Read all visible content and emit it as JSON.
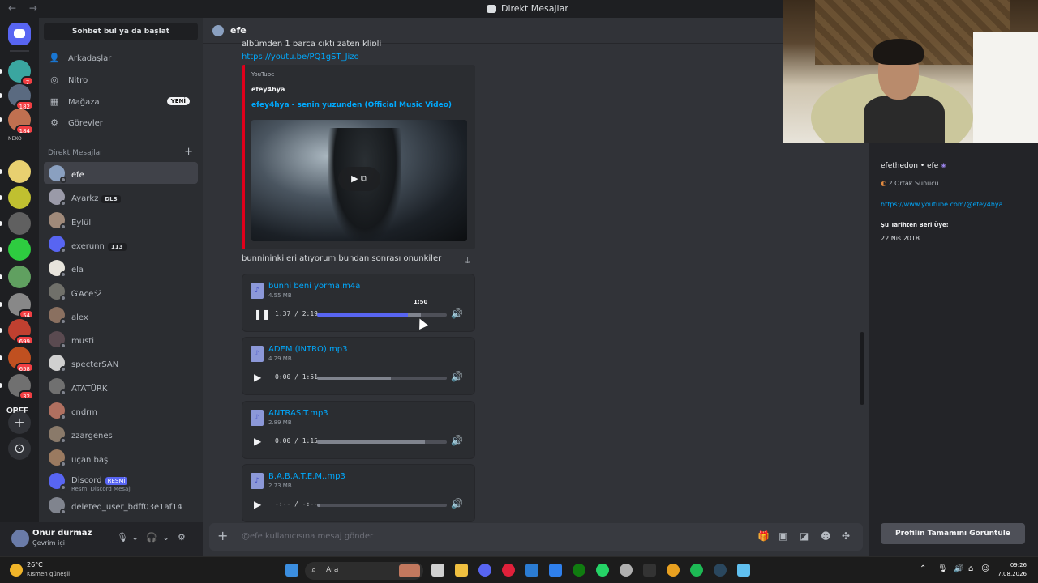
{
  "titlebar": {
    "nav": "← →",
    "title": "Direkt Mesajlar"
  },
  "rail": {
    "servers": [
      {
        "badge": "7"
      },
      {
        "badge": "182"
      },
      {
        "badge": "184"
      },
      {
        "badge": ""
      },
      {
        "badge": ""
      },
      {
        "badge": ""
      },
      {
        "badge": ""
      },
      {
        "badge": ""
      },
      {
        "badge": "54"
      },
      {
        "badge": "699"
      },
      {
        "badge": "658"
      },
      {
        "badge": "32"
      }
    ],
    "text_server": "OBFF",
    "add_label": "+",
    "explore_label": "⊙"
  },
  "sidebar": {
    "search_label": "Sohbet bul ya da başlat",
    "nav": [
      {
        "label": "Arkadaşlar",
        "icon": "friends-icon"
      },
      {
        "label": "Nitro",
        "icon": "nitro-icon"
      },
      {
        "label": "Mağaza",
        "icon": "shop-icon",
        "badge": "YENİ"
      },
      {
        "label": "Görevler",
        "icon": "quests-icon"
      }
    ],
    "dm_header": "Direkt Mesajlar",
    "dm_add": "+",
    "dms": [
      {
        "name": "efe",
        "color": "#8aa0c0",
        "active": true
      },
      {
        "name": "Ayarkz",
        "color": "#9a9aa8",
        "tag": "DLS"
      },
      {
        "name": "Eylül",
        "color": "#a08a7a"
      },
      {
        "name": "exerunn",
        "color": "#5865f2",
        "tag": "113"
      },
      {
        "name": "ela",
        "color": "#e7e4dc"
      },
      {
        "name": "ᏳAceジ",
        "color": "#70706a"
      },
      {
        "name": "alex",
        "color": "#8a7060"
      },
      {
        "name": "musti",
        "color": "#5a4a50"
      },
      {
        "name": "specterSAN",
        "color": "#d0d0d0"
      },
      {
        "name": "ATATÜRK",
        "color": "#707070"
      },
      {
        "name": "cndrm",
        "color": "#b07060"
      },
      {
        "name": "zzargenes",
        "color": "#8a7a6a"
      },
      {
        "name": "uçan baş",
        "color": "#9a7a60"
      },
      {
        "name": "Discord",
        "color": "#5865f2",
        "tag": "RESMİ",
        "sub": "Resmi Discord Mesajı"
      },
      {
        "name": "deleted_user_bdff03e1af14",
        "color": "#80848e"
      }
    ]
  },
  "user": {
    "name": "Onur durmaz",
    "status": "Çevrim içi",
    "mic": "🎙",
    "headset": "🎧",
    "settings": "⚙",
    "caret": "⌄"
  },
  "chat": {
    "header": "efe",
    "partial_text": "albümden 1 parça çıktı zaten klipli",
    "link": "https://youtu.be/PQ1gST_Jizo",
    "embed": {
      "provider": "YouTube",
      "author": "efey4hya",
      "title": "efey4hya - senin yuzunden (Official Music Video)",
      "play": "▶ ⧉"
    },
    "message2": "bunnininkileri atıyorum bundan sonrası onunkiler",
    "audios": [
      {
        "name": "bunni beni yorma.m4a",
        "size": "4.55 MB",
        "time": "1:37 / 2:19",
        "progress": 0.7,
        "buffered": 0.8,
        "play": "❚❚",
        "hover": "1:50"
      },
      {
        "name": "ADEM (INTRO).mp3",
        "size": "4.29 MB",
        "time": "0:00 / 1:51",
        "progress": 0.0,
        "buffered": 0.57,
        "play": "▶"
      },
      {
        "name": "ANTRASIT.mp3",
        "size": "2.89 MB",
        "time": "0:00 / 1:15",
        "progress": 0.0,
        "buffered": 0.83,
        "play": "▶"
      },
      {
        "name": "B.A.B.A.T.E.M..mp3",
        "size": "2.73 MB",
        "time": "-:-- / -:--",
        "progress": 0.0,
        "buffered": 0.02,
        "play": "▶"
      }
    ],
    "input_placeholder": "@efe kullanıcısına mesaj gönder",
    "input_plus": "+"
  },
  "profile": {
    "handle": "efethedon",
    "display": "efe",
    "mutual": "2 Ortak Sunucu",
    "link": "https://www.youtube.com/@efey4hya",
    "member_since_label": "Şu Tarihten Beri Üye:",
    "member_since": "22 Nis 2018",
    "full_button": "Profilin Tamamını Görüntüle"
  },
  "taskbar": {
    "temp": "26°C",
    "weather": "Kısmen güneşli",
    "search_placeholder": "Ara",
    "time": "09:26",
    "date": "7.08.2026"
  },
  "colors": {
    "accent": "#5865f2",
    "link": "#00a8fc",
    "youtube": "#e0001b"
  }
}
